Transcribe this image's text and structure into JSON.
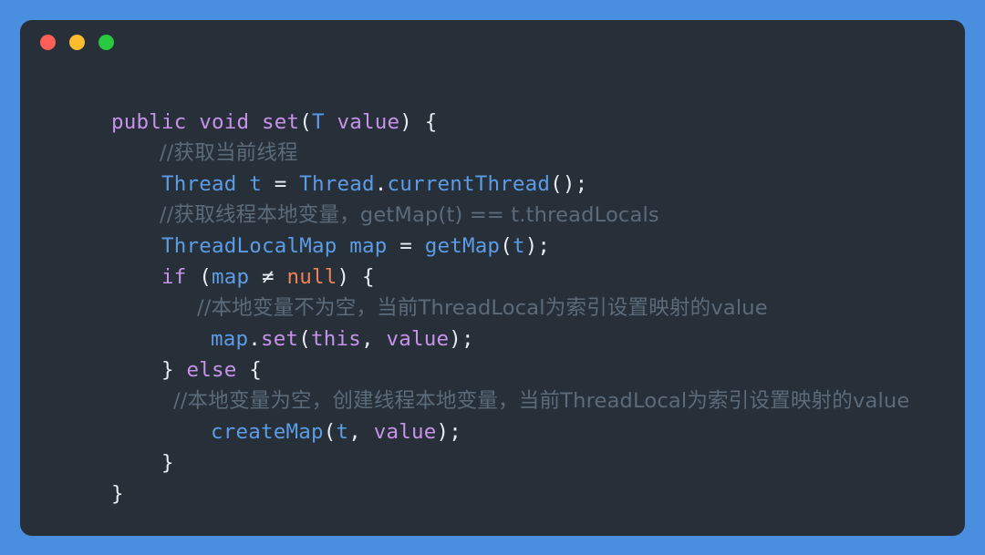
{
  "window": {
    "card_background": "#272f38",
    "page_background": "#4a8ee0",
    "traffic_lights": [
      {
        "name": "close",
        "color": "#ff5f57"
      },
      {
        "name": "minimize",
        "color": "#fdbc2e"
      },
      {
        "name": "maximize",
        "color": "#28c840"
      }
    ]
  },
  "code": {
    "language": "Java",
    "lines": [
      {
        "n": 1,
        "indent": 1,
        "text": "public void set(T value) {",
        "tokens": [
          {
            "t": "public void ",
            "c": "kw"
          },
          {
            "t": "set",
            "c": "fn"
          },
          {
            "t": "(",
            "c": "punc"
          },
          {
            "t": "T",
            "c": "type"
          },
          {
            "t": " ",
            "c": "punc"
          },
          {
            "t": "value",
            "c": "param"
          },
          {
            "t": ") {",
            "c": "punc"
          }
        ]
      },
      {
        "n": 2,
        "indent": 2,
        "comment": true,
        "text": "//获取当前线程"
      },
      {
        "n": 3,
        "indent": 2,
        "text": "Thread t = Thread.currentThread();",
        "tokens": [
          {
            "t": "Thread",
            "c": "type"
          },
          {
            "t": " ",
            "c": "punc"
          },
          {
            "t": "t",
            "c": "var"
          },
          {
            "t": " = ",
            "c": "op"
          },
          {
            "t": "Thread",
            "c": "type"
          },
          {
            "t": ".",
            "c": "punc"
          },
          {
            "t": "currentThread",
            "c": "var"
          },
          {
            "t": "();",
            "c": "punc"
          }
        ]
      },
      {
        "n": 4,
        "indent": 2,
        "comment": true,
        "text": "//获取线程本地变量，getMap(t) == t.threadLocals"
      },
      {
        "n": 5,
        "indent": 2,
        "text": "ThreadLocalMap map = getMap(t);",
        "tokens": [
          {
            "t": "ThreadLocalMap",
            "c": "type"
          },
          {
            "t": " ",
            "c": "punc"
          },
          {
            "t": "map",
            "c": "var"
          },
          {
            "t": " = ",
            "c": "op"
          },
          {
            "t": "getMap",
            "c": "var"
          },
          {
            "t": "(",
            "c": "punc"
          },
          {
            "t": "t",
            "c": "var"
          },
          {
            "t": ");",
            "c": "punc"
          }
        ]
      },
      {
        "n": 6,
        "indent": 2,
        "text": "if (map != null) {",
        "tokens": [
          {
            "t": "if",
            "c": "kw"
          },
          {
            "t": " (",
            "c": "punc"
          },
          {
            "t": "map",
            "c": "var"
          },
          {
            "t": " ≠ ",
            "c": "op"
          },
          {
            "t": "null",
            "c": "null"
          },
          {
            "t": ") {",
            "c": "punc"
          }
        ]
      },
      {
        "n": 7,
        "indent": 3,
        "comment": true,
        "text": "//本地变量不为空，当前ThreadLocal为索引设置映射的value"
      },
      {
        "n": 8,
        "indent": 3,
        "text": "map.set(this, value);",
        "tokens": [
          {
            "t": "map",
            "c": "var"
          },
          {
            "t": ".",
            "c": "punc"
          },
          {
            "t": "set",
            "c": "fn"
          },
          {
            "t": "(",
            "c": "punc"
          },
          {
            "t": "this",
            "c": "kw"
          },
          {
            "t": ", ",
            "c": "punc"
          },
          {
            "t": "value",
            "c": "param"
          },
          {
            "t": ");",
            "c": "punc"
          }
        ]
      },
      {
        "n": 9,
        "indent": 2,
        "text": "} else {",
        "tokens": [
          {
            "t": "} ",
            "c": "punc"
          },
          {
            "t": "else",
            "c": "kw"
          },
          {
            "t": " {",
            "c": "punc"
          }
        ]
      },
      {
        "n": 10,
        "indent": 3,
        "comment": true,
        "text": "//本地变量为空，创建线程本地变量，当前ThreadLocal为索引设置映射的value"
      },
      {
        "n": 11,
        "indent": 3,
        "text": "createMap(t, value);",
        "tokens": [
          {
            "t": "createMap",
            "c": "var"
          },
          {
            "t": "(",
            "c": "punc"
          },
          {
            "t": "t",
            "c": "var"
          },
          {
            "t": ", ",
            "c": "punc"
          },
          {
            "t": "value",
            "c": "param"
          },
          {
            "t": ");",
            "c": "punc"
          }
        ]
      },
      {
        "n": 12,
        "indent": 2,
        "text": "}",
        "tokens": [
          {
            "t": "}",
            "c": "punc"
          }
        ]
      },
      {
        "n": 13,
        "indent": 1,
        "text": "}",
        "tokens": [
          {
            "t": "}",
            "c": "punc"
          }
        ]
      }
    ]
  },
  "colors": {
    "keyword": "#c792ea",
    "type": "#5c9ce6",
    "variable": "#5c9ce6",
    "parameter": "#c792ea",
    "null_literal": "#f07f58",
    "punctuation": "#e6edf3",
    "comment": "#5b6b7a"
  }
}
